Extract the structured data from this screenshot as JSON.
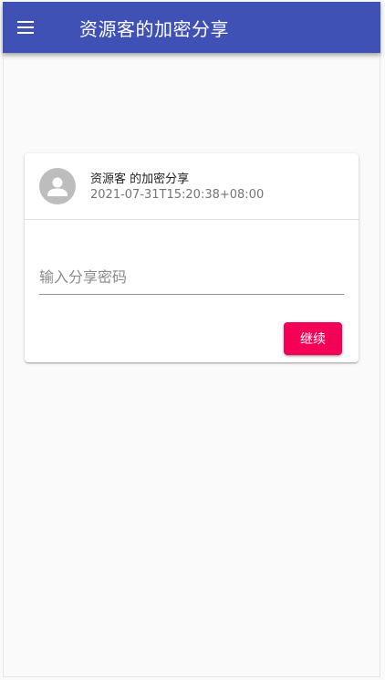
{
  "appbar": {
    "title": "资源客的加密分享",
    "background_color": "#3f51b5",
    "menu_icon": "hamburger-menu-icon"
  },
  "share_card": {
    "owner_text": "资源客 的加密分享",
    "timestamp": "2021-07-31T15:20:38+08:00",
    "avatar_icon": "person-avatar-icon",
    "password_field": {
      "value": "",
      "placeholder": "输入分享密码"
    },
    "continue_button": {
      "label": "继续",
      "color": "#f50057"
    }
  }
}
